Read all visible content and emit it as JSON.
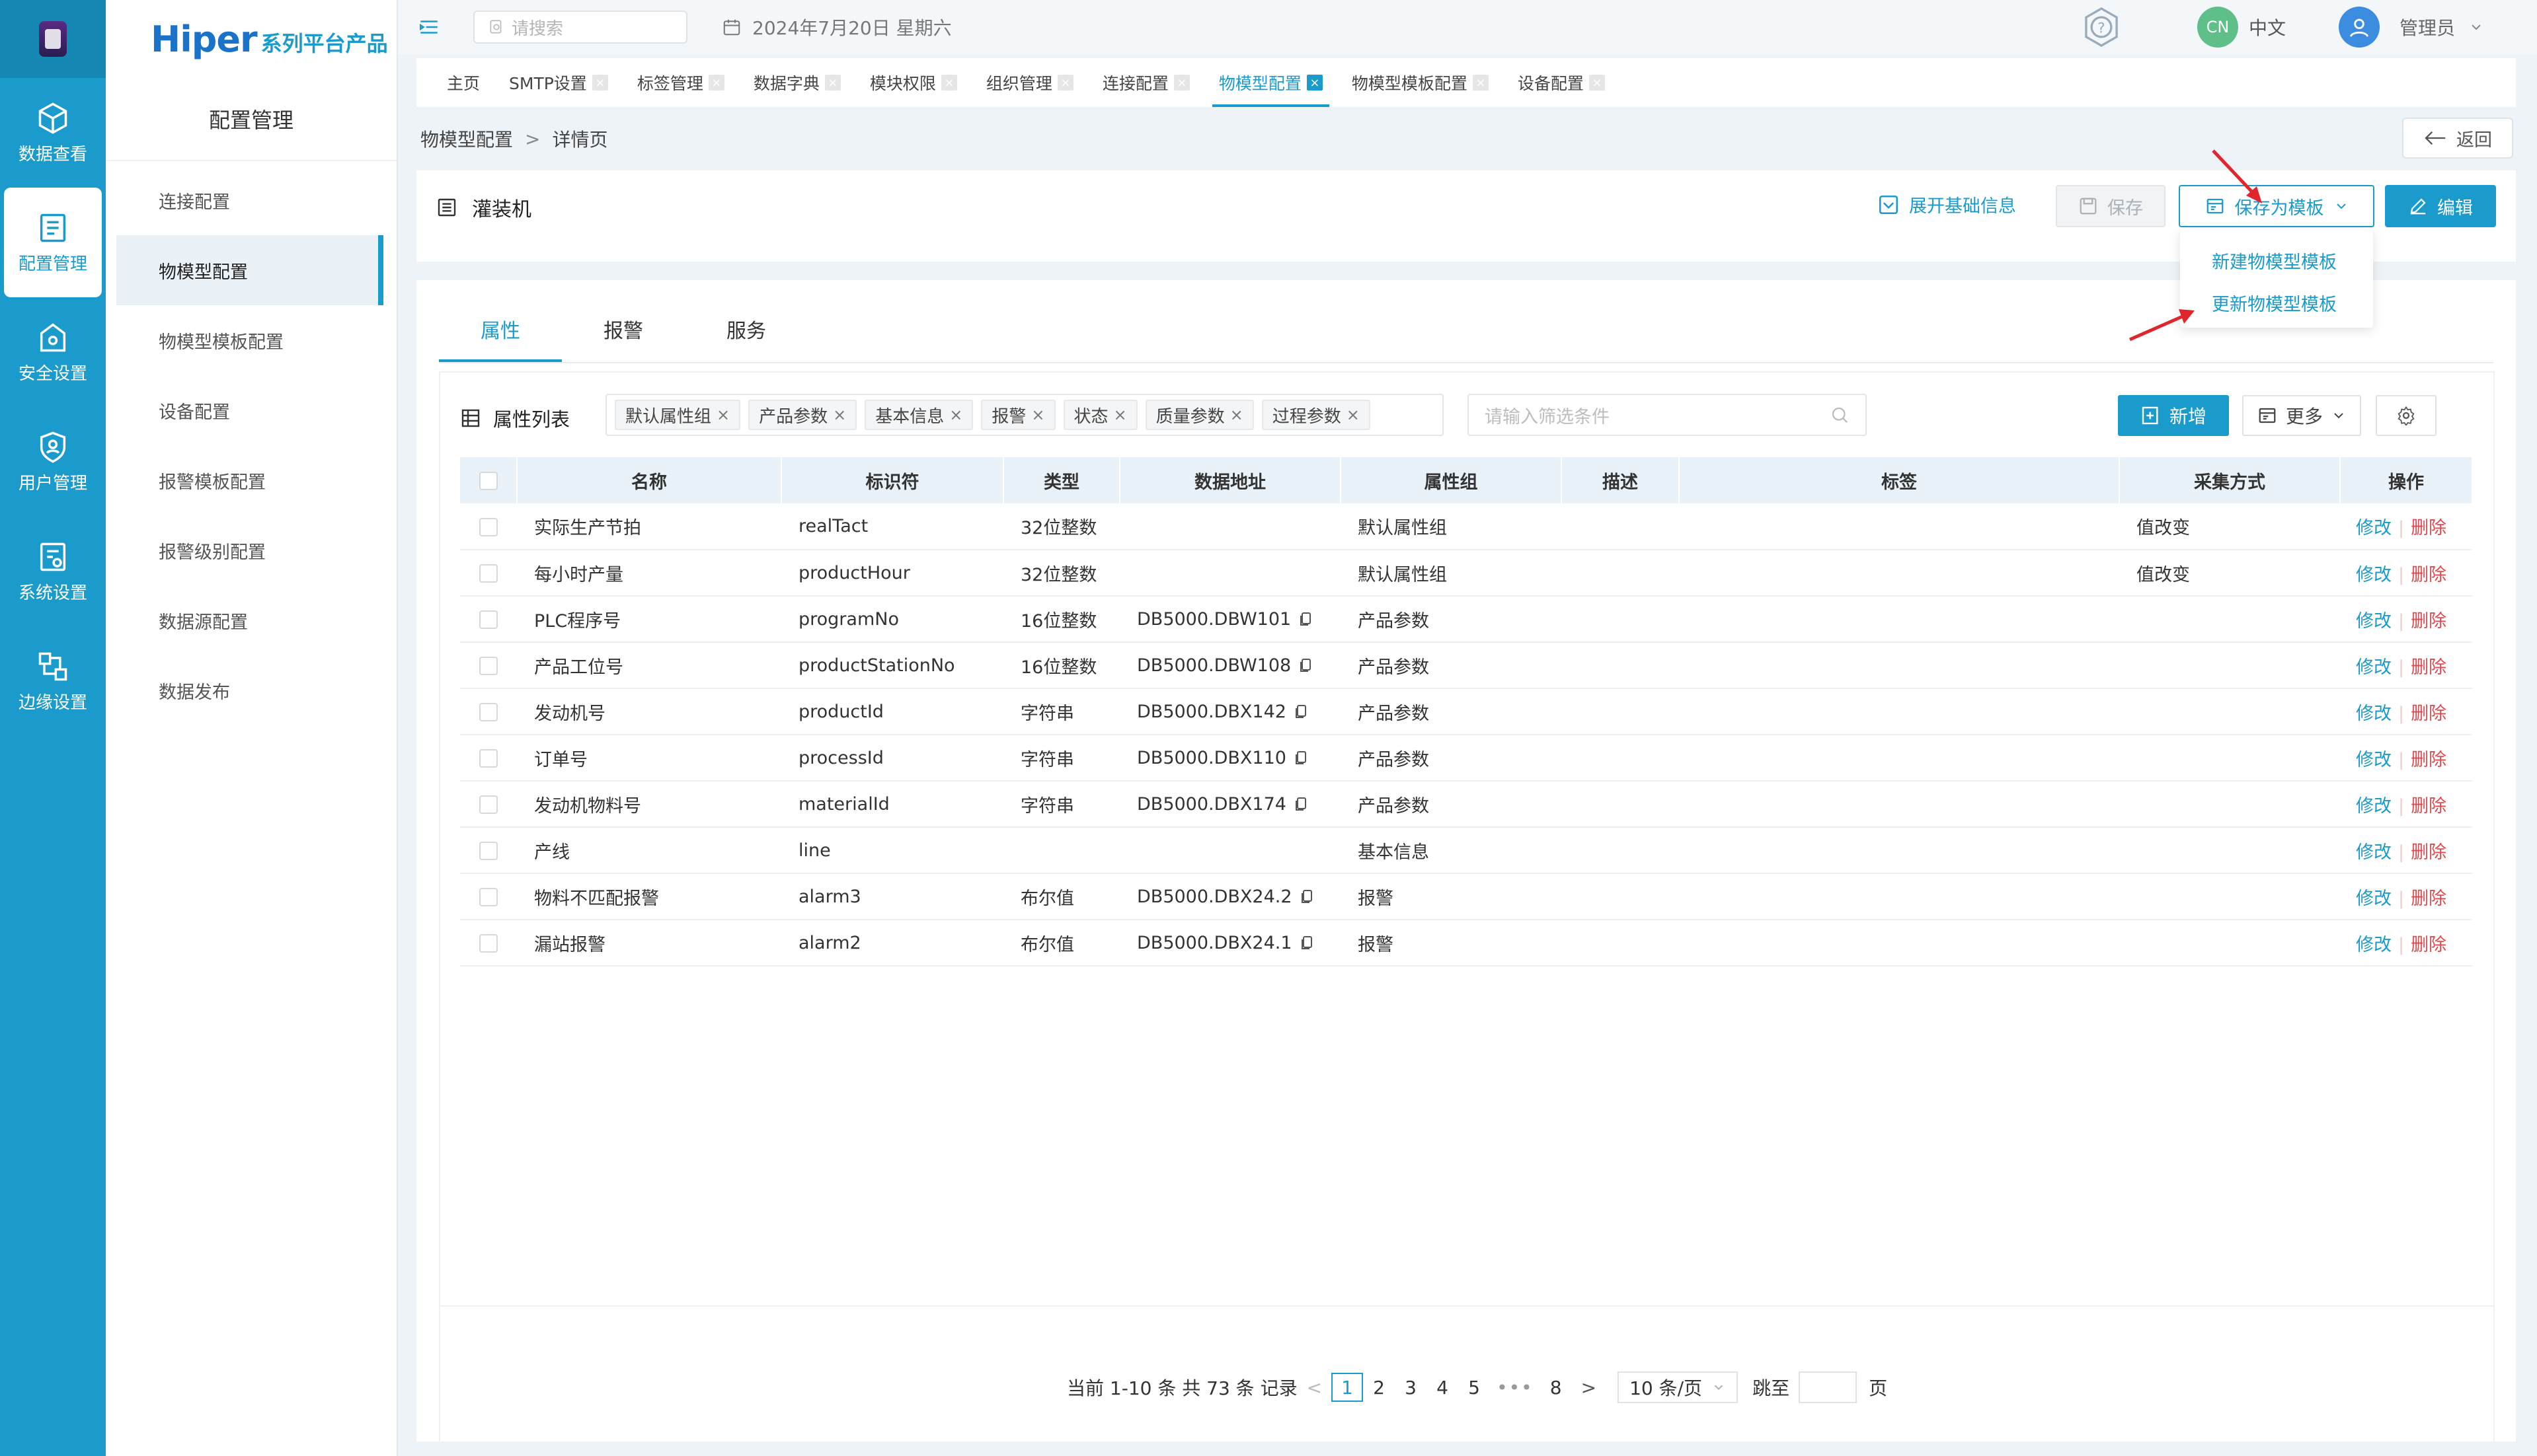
{
  "brand": {
    "name": "Hiper",
    "subtitle": "系列平台产品"
  },
  "rail": [
    {
      "label": "数据查看",
      "icon": "cube-icon",
      "active": false
    },
    {
      "label": "配置管理",
      "icon": "config-icon",
      "active": true
    },
    {
      "label": "安全设置",
      "icon": "security-icon",
      "active": false
    },
    {
      "label": "用户管理",
      "icon": "user-shield-icon",
      "active": false
    },
    {
      "label": "系统设置",
      "icon": "system-icon",
      "active": false
    },
    {
      "label": "边缘设置",
      "icon": "edge-icon",
      "active": false
    }
  ],
  "submenu": {
    "title": "配置管理",
    "items": [
      "连接配置",
      "物模型配置",
      "物模型模板配置",
      "设备配置",
      "报警模板配置",
      "报警级别配置",
      "数据源配置",
      "数据发布"
    ],
    "active_index": 1
  },
  "header": {
    "search_placeholder": "请搜索",
    "date": "2024年7月20日 星期六",
    "lang_badge": "CN",
    "lang": "中文",
    "user": "管理员"
  },
  "tabs": [
    {
      "label": "主页",
      "closable": false
    },
    {
      "label": "SMTP设置",
      "closable": true
    },
    {
      "label": "标签管理",
      "closable": true
    },
    {
      "label": "数据字典",
      "closable": true
    },
    {
      "label": "模块权限",
      "closable": true
    },
    {
      "label": "组织管理",
      "closable": true
    },
    {
      "label": "连接配置",
      "closable": true
    },
    {
      "label": "物模型配置",
      "closable": true,
      "active": true
    },
    {
      "label": "物模型模板配置",
      "closable": true
    },
    {
      "label": "设备配置",
      "closable": true
    }
  ],
  "breadcrumb": {
    "parent": "物模型配置",
    "sep": ">",
    "current": "详情页"
  },
  "back_label": "返回",
  "model": {
    "name": "灌装机",
    "expand_label": "展开基础信息",
    "save_label": "保存",
    "save_template_label": "保存为模板",
    "edit_label": "编辑"
  },
  "template_menu": [
    "新建物模型模板",
    "更新物模型模板"
  ],
  "prop_tabs": [
    "属性",
    "报警",
    "服务"
  ],
  "list": {
    "title": "属性列表",
    "chips": [
      "默认属性组",
      "产品参数",
      "基本信息",
      "报警",
      "状态",
      "质量参数",
      "过程参数"
    ],
    "filter_placeholder": "请输入筛选条件",
    "add_label": "新增",
    "more_label": "更多"
  },
  "table": {
    "columns": [
      "名称",
      "标识符",
      "类型",
      "数据地址",
      "属性组",
      "描述",
      "标签",
      "采集方式",
      "操作"
    ],
    "rows": [
      [
        "实际生产节拍",
        "realTact",
        "32位整数",
        "",
        "默认属性组",
        "",
        "",
        "值改变"
      ],
      [
        "每小时产量",
        "productHour",
        "32位整数",
        "",
        "默认属性组",
        "",
        "",
        "值改变"
      ],
      [
        "PLC程序号",
        "programNo",
        "16位整数",
        "DB5000.DBW101",
        "产品参数",
        "",
        "",
        ""
      ],
      [
        "产品工位号",
        "productStationNo",
        "16位整数",
        "DB5000.DBW108",
        "产品参数",
        "",
        "",
        ""
      ],
      [
        "发动机号",
        "productId",
        "字符串",
        "DB5000.DBX142",
        "产品参数",
        "",
        "",
        ""
      ],
      [
        "订单号",
        "processId",
        "字符串",
        "DB5000.DBX110",
        "产品参数",
        "",
        "",
        ""
      ],
      [
        "发动机物料号",
        "materialId",
        "字符串",
        "DB5000.DBX174",
        "产品参数",
        "",
        "",
        ""
      ],
      [
        "产线",
        "line",
        "",
        "",
        "基本信息",
        "",
        "",
        ""
      ],
      [
        "物料不匹配报警",
        "alarm3",
        "布尔值",
        "DB5000.DBX24.2",
        "报警",
        "",
        "",
        ""
      ],
      [
        "漏站报警",
        "alarm2",
        "布尔值",
        "DB5000.DBX24.1",
        "报警",
        "",
        "",
        ""
      ]
    ],
    "edit_label": "修改",
    "delete_label": "删除",
    "op_sep": "|"
  },
  "pagination": {
    "summary": "当前 1-10 条 共 73 条 记录",
    "pages": [
      "1",
      "2",
      "3",
      "4",
      "5"
    ],
    "dots": "•••",
    "last_page": "8",
    "current": "1",
    "page_size": "10 条/页",
    "jump_label": "跳至",
    "page_unit": "页"
  },
  "colors": {
    "primary": "#1a9bcb",
    "danger": "#e0484d",
    "rail": "#1a9bcb"
  }
}
